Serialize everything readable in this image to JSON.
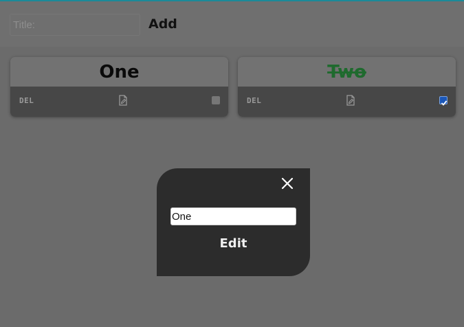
{
  "header": {
    "title_placeholder": "Title:",
    "add_label": "Add"
  },
  "todos": [
    {
      "title": "One",
      "delete_label": "DEL",
      "edit_icon": "edit-file-icon",
      "done": false
    },
    {
      "title": "Two",
      "delete_label": "DEL",
      "edit_icon": "edit-file-icon",
      "done": true
    }
  ],
  "modal": {
    "close_icon": "close-icon",
    "input_value": "One",
    "edit_label": "Edit"
  },
  "colors": {
    "background": "#6b6b6b",
    "card_footer": "#474747",
    "done_title": "#1f6a2e",
    "checkbox_checked": "#1b57b8",
    "modal_background": "#2c2c2c"
  }
}
